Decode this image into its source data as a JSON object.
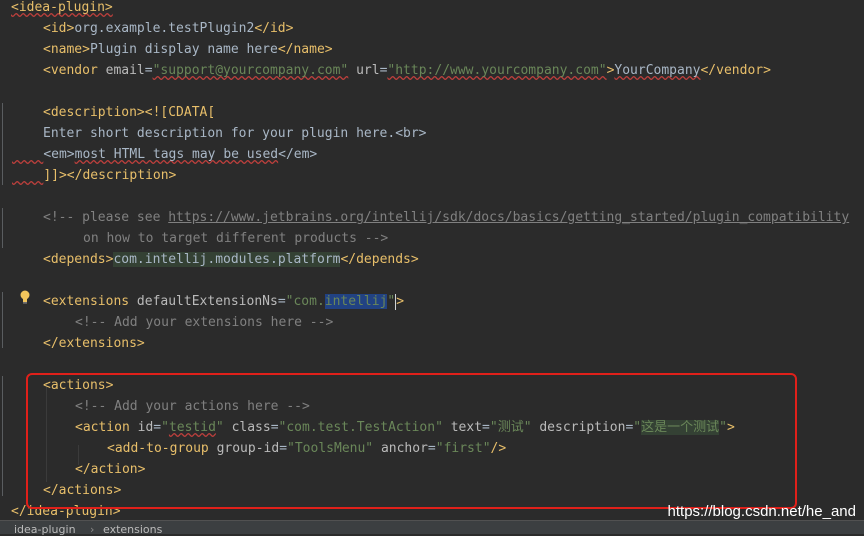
{
  "editor": {
    "l1": {
      "open": "<idea-plugin>"
    },
    "l2": {
      "open": "<id>",
      "text": "org.example.testPlugin2",
      "close": "</id>"
    },
    "l3": {
      "open": "<name>",
      "text": "Plugin display name here",
      "close": "</name>"
    },
    "l4": {
      "open": "<vendor",
      "email_attr": "email",
      "email_val": "\"support@yourcompany.com\"",
      "url_attr": "url",
      "url_val": "\"http://www.yourcompany.com\"",
      "gt": ">",
      "text": "YourCompany",
      "close": "</vendor>"
    },
    "l6": {
      "open": "<description>",
      "cdata": "<![CDATA["
    },
    "l7": {
      "text1": "Enter short description for your plugin here.",
      "br": "<br>"
    },
    "l8": {
      "em_open": "<em>",
      "text": "most HTML tags may be used",
      "em_close": "</em>"
    },
    "l9": {
      "cdata_end": "]]>",
      "close": "</description>"
    },
    "l11": {
      "comment": "<!-- please see ",
      "link": "https://www.jetbrains.org/intellij/sdk/docs/basics/getting_started/plugin_compatibility"
    },
    "l12": {
      "comment": "on how to target different products -->"
    },
    "l13": {
      "open": "<depends>",
      "text": "com.intellij.modules.platform",
      "close": "</depends>"
    },
    "l15": {
      "open": "<extensions",
      "attr": "defaultExtensionNs",
      "val_pre": "\"com.",
      "val_sel": "intellij",
      "val_post": "\"",
      "gt": ">"
    },
    "l16": {
      "comment": "<!-- Add your extensions here -->"
    },
    "l17": {
      "close": "</extensions>"
    },
    "l19": {
      "open": "<actions>"
    },
    "l20": {
      "comment": "<!-- Add your actions here -->"
    },
    "l21": {
      "open": "<action",
      "id_attr": "id",
      "id_val_q1": "\"",
      "id_val": "testid",
      "id_val_q2": "\"",
      "class_attr": "class",
      "class_val": "\"com.test.TestAction\"",
      "text_attr": "text",
      "text_val": "\"测试\"",
      "desc_attr": "description",
      "desc_q1": "\"",
      "desc_val": "这是一个测试",
      "desc_q2": "\"",
      "gt": ">"
    },
    "l22": {
      "open": "<add-to-group",
      "gid_attr": "group-id",
      "gid_val": "\"ToolsMenu\"",
      "anchor_attr": "anchor",
      "anchor_val": "\"first\"",
      "end": "/>"
    },
    "l23": {
      "close": "</action>"
    },
    "l24": {
      "close": "</actions>"
    },
    "l25": {
      "close": "</idea-plugin>"
    }
  },
  "breadcrumb": {
    "item1": "idea-plugin",
    "sep": "›",
    "item2": "extensions"
  },
  "watermark": "https://blog.csdn.net/he_and",
  "colors": {
    "background": "#2b2b2b",
    "tag": "#e8bf6a",
    "string": "#6a8759",
    "comment": "#808080",
    "annotation_box": "#e0201a"
  },
  "icons": {
    "bulb": "intention-bulb-icon"
  }
}
